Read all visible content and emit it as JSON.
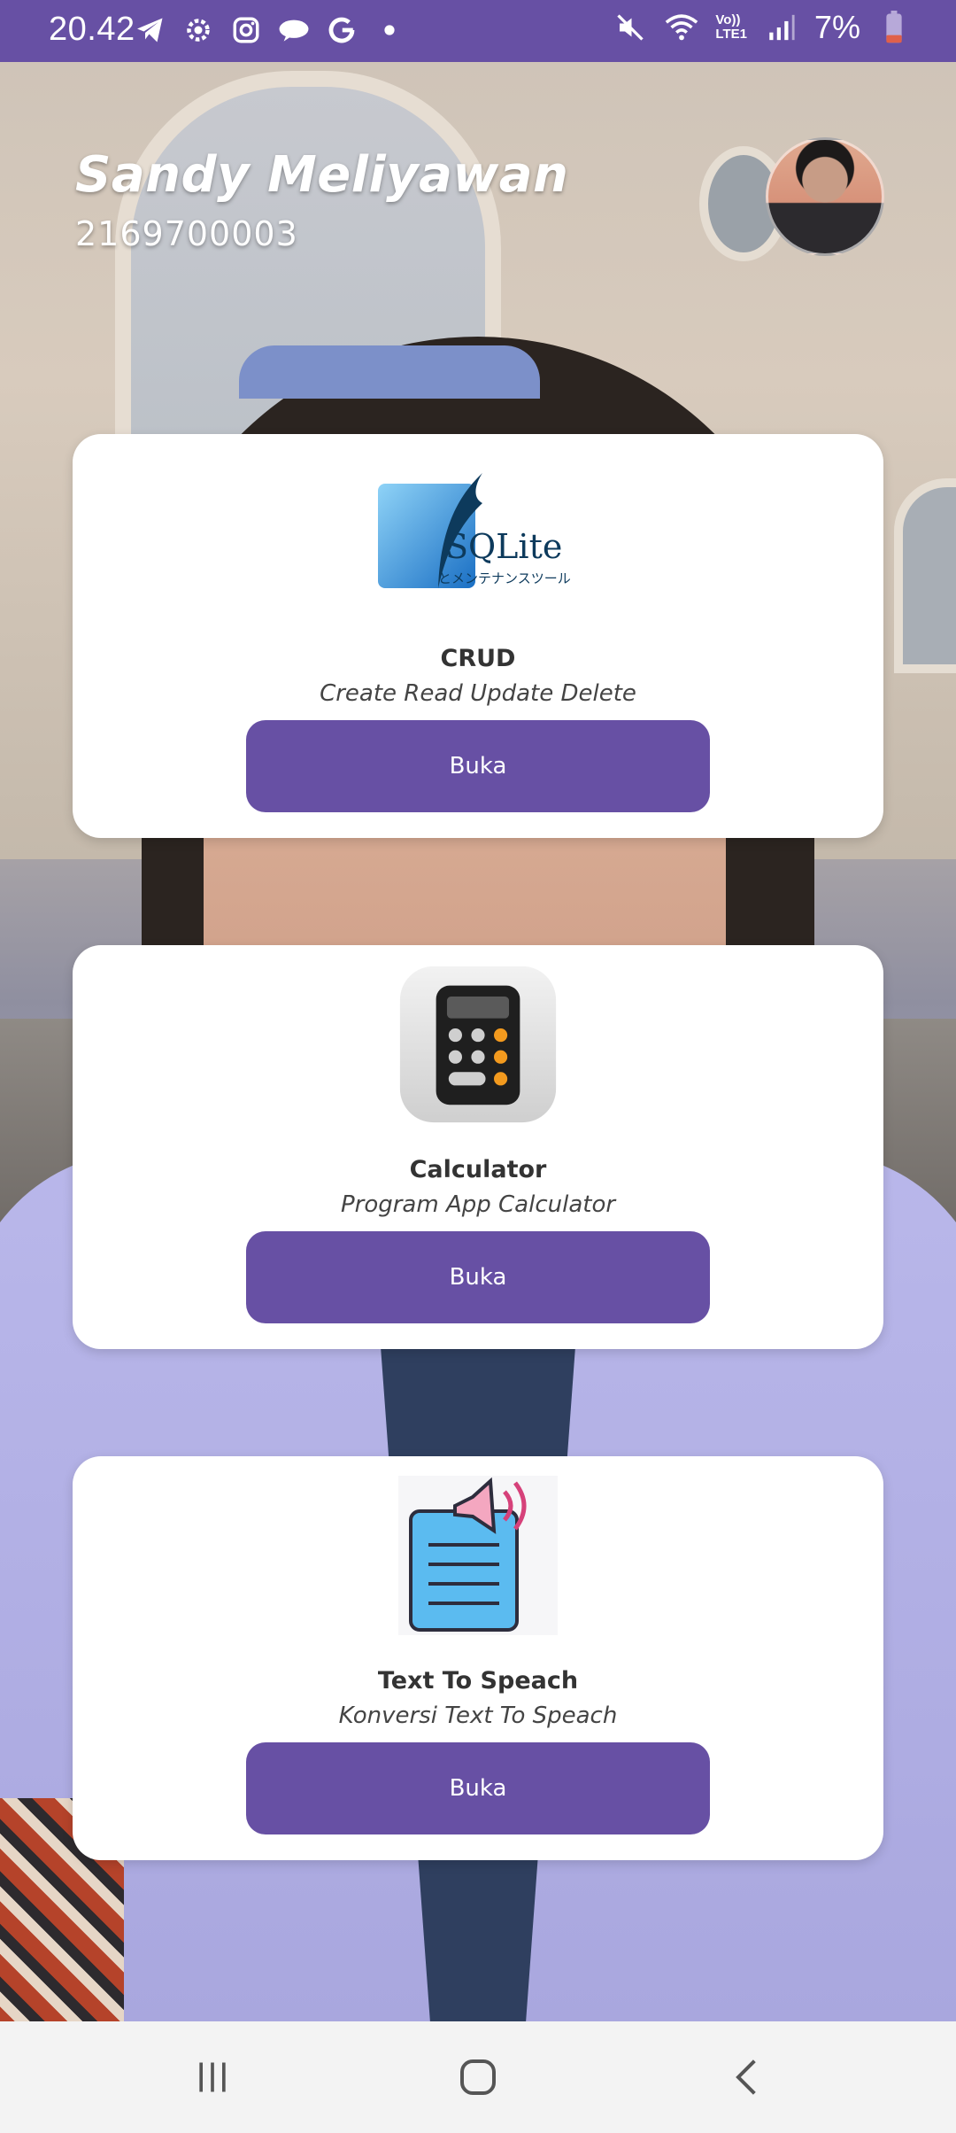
{
  "status_bar": {
    "time": "20.42",
    "network_label_top": "Vo))",
    "network_label_bottom": "LTE1",
    "battery": "7%"
  },
  "header": {
    "name": "Sandy Meliyawan",
    "nim": "2169700003"
  },
  "cards": [
    {
      "icon": "sqlite-logo-icon",
      "logo_text": "SQLite",
      "logo_subtext": "とメンテナンスツール",
      "title": "CRUD",
      "subtitle": "Create Read Update Delete",
      "button_label": "Buka"
    },
    {
      "icon": "calculator-icon",
      "title": "Calculator",
      "subtitle": "Program App Calculator",
      "button_label": "Buka"
    },
    {
      "icon": "text-to-speech-icon",
      "title": "Text To Speach",
      "subtitle": "Konversi Text To Speach",
      "button_label": "Buka"
    }
  ],
  "colors": {
    "primary": "#6750a4",
    "card_bg": "#ffffff",
    "navbar_bg": "#f3f3f3"
  }
}
